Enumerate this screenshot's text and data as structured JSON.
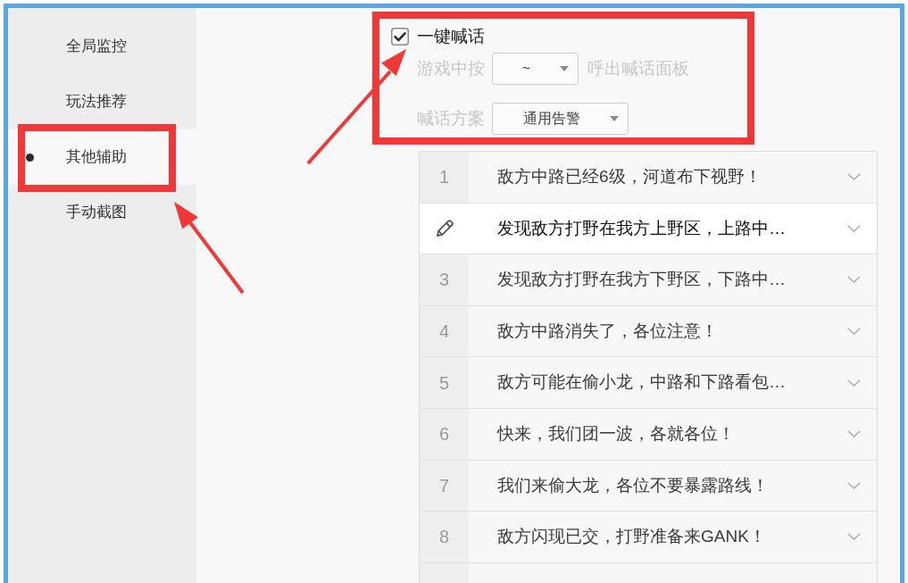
{
  "sidebar": {
    "items": [
      {
        "label": "全局监控",
        "selected": false
      },
      {
        "label": "玩法推荐",
        "selected": false
      },
      {
        "label": "其他辅助",
        "selected": true
      },
      {
        "label": "手动截图",
        "selected": false
      }
    ]
  },
  "quick_chat": {
    "label": "一键喊话",
    "checked": true,
    "hotkey_prefix": "游戏中按",
    "hotkey_value": "~",
    "hotkey_suffix": "呼出喊话面板",
    "scheme_label": "喊话方案",
    "scheme_value": "通用告警"
  },
  "phrases": [
    {
      "number": "1",
      "text": "敌方中路已经6级，河道布下视野！",
      "selected": false
    },
    {
      "text": "发现敌方打野在我方上野区，上路中…",
      "selected": true
    },
    {
      "number": "3",
      "text": "发现敌方打野在我方下野区，下路中…",
      "selected": false
    },
    {
      "number": "4",
      "text": "敌方中路消失了，各位注意！",
      "selected": false
    },
    {
      "number": "5",
      "text": "敌方可能在偷小龙，中路和下路看包…",
      "selected": false
    },
    {
      "number": "6",
      "text": "快来，我们团一波，各就各位！",
      "selected": false
    },
    {
      "number": "7",
      "text": "我们来偷大龙，各位不要暴露路线！",
      "selected": false
    },
    {
      "number": "8",
      "text": "敌方闪现已交，打野准备来GANK！",
      "selected": false
    }
  ]
}
